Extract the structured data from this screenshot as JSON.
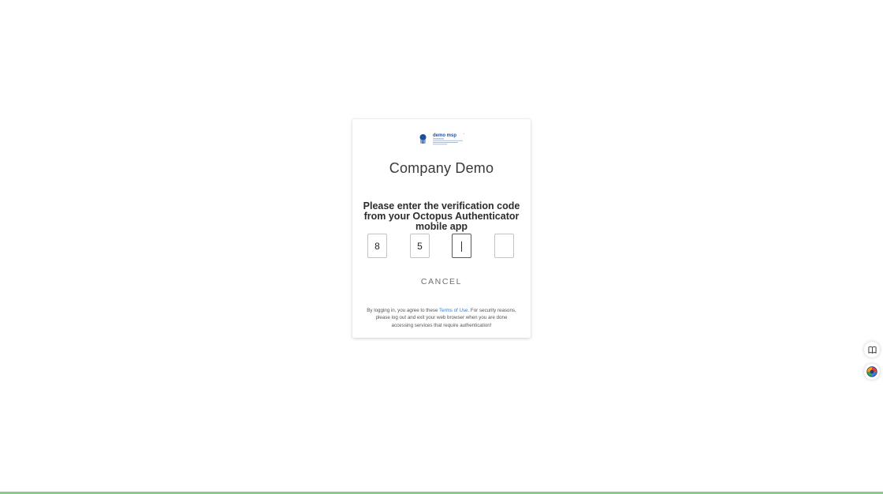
{
  "card": {
    "logo_alt": "demo msp",
    "company_name": "Company Demo",
    "prompt": "Please enter the verification code from your Octopus Authenticator mobile app",
    "digits": [
      "8",
      "5",
      "",
      ""
    ],
    "cancel_label": "CANCEL",
    "terms": {
      "before": "By logging in, you agree to these ",
      "link": "Terms of Use",
      "after": ". For security reasons, please log out and exit your web browser when you are done accessing services that require authentication!"
    }
  },
  "side_buttons": {
    "book_icon": "book-icon",
    "globe_icon": "color-globe-icon"
  },
  "colors": {
    "accent_link": "#3b7bc8",
    "bottom_bar": "#8bc98c",
    "logo_blue": "#1e4f9a"
  }
}
